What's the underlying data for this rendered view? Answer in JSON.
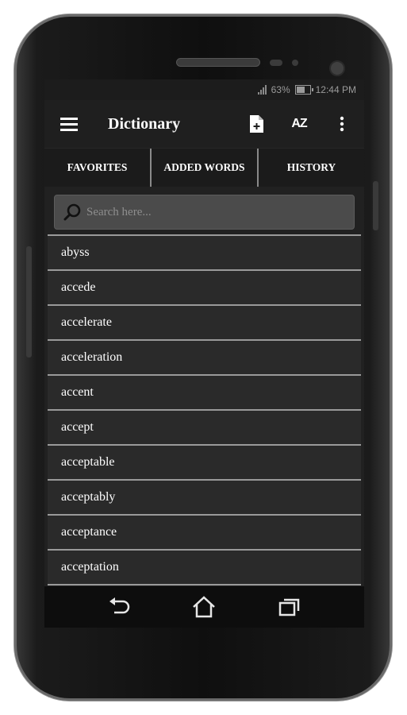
{
  "status": {
    "battery_text": "63%",
    "battery_level": 0.63,
    "time": "12:44 PM"
  },
  "toolbar": {
    "title": "Dictionary",
    "menu_icon": "hamburger-menu-icon",
    "add_icon": "add-file-icon",
    "sort_icon_label": "AZ",
    "more_icon": "more-vertical-icon"
  },
  "tabs": [
    {
      "label": "FAVORITES"
    },
    {
      "label": "ADDED WORDS"
    },
    {
      "label": "HISTORY"
    }
  ],
  "search": {
    "placeholder": "Search here...",
    "value": ""
  },
  "words": [
    {
      "label": "abyss"
    },
    {
      "label": "accede"
    },
    {
      "label": "accelerate"
    },
    {
      "label": "acceleration"
    },
    {
      "label": "accent"
    },
    {
      "label": "accept"
    },
    {
      "label": "acceptable"
    },
    {
      "label": "acceptably"
    },
    {
      "label": "acceptance"
    },
    {
      "label": "acceptation"
    }
  ],
  "colors": {
    "screen_bg": "#212121",
    "row_bg": "#2a2a2a",
    "divider": "#9a9a9a",
    "text": "#ffffff"
  }
}
